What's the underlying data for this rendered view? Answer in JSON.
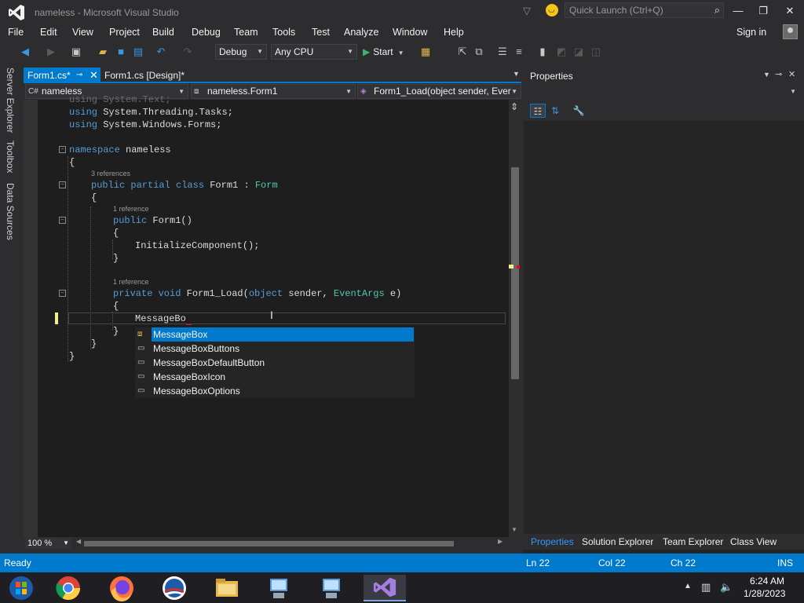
{
  "window": {
    "title": "nameless - Microsoft Visual Studio",
    "quick_launch_placeholder": "Quick Launch (Ctrl+Q)"
  },
  "menu": [
    "File",
    "Edit",
    "View",
    "Project",
    "Build",
    "Debug",
    "Team",
    "Tools",
    "Test",
    "Analyze",
    "Window",
    "Help"
  ],
  "sign_in": "Sign in",
  "toolbar": {
    "config": "Debug",
    "platform": "Any CPU",
    "start": "Start"
  },
  "left_tabs": [
    "Server Explorer",
    "Toolbox",
    "Data Sources"
  ],
  "doc_tabs": {
    "active": "Form1.cs*",
    "other": "Form1.cs [Design]*"
  },
  "navbar": {
    "project": "nameless",
    "class": "nameless.Form1",
    "member": "Form1_Load(object sender, Ever"
  },
  "code": {
    "using1": "using System.Text;",
    "using2_kw": "using",
    "using2_rest": " System.Threading.Tasks;",
    "using3_kw": "using",
    "using3_rest": " System.Windows.Forms;",
    "ns_kw": "namespace",
    "ns_name": " nameless",
    "brace_open": "{",
    "brace_close": "}",
    "lens_class": "3 references",
    "class_kw": "public partial class",
    "class_name": " Form1 ",
    "class_colon": ": ",
    "class_base": "Form",
    "lens_ctor": "1 reference",
    "ctor_kw": "public",
    "ctor_rest": " Form1()",
    "init": "InitializeComponent();",
    "lens_load": "1 reference",
    "load_kw": "private void",
    "load_name": " Form1_Load(",
    "load_obj": "object",
    "load_sender": " sender, ",
    "load_type": "EventArgs",
    "load_e": " e)",
    "typing": "MessageBo"
  },
  "intellisense": [
    {
      "label": "MessageBox",
      "icon": "class-icon",
      "selected": true
    },
    {
      "label": "MessageBoxButtons",
      "icon": "enum-icon",
      "selected": false
    },
    {
      "label": "MessageBoxDefaultButton",
      "icon": "enum-icon",
      "selected": false
    },
    {
      "label": "MessageBoxIcon",
      "icon": "enum-icon",
      "selected": false
    },
    {
      "label": "MessageBoxOptions",
      "icon": "enum-icon",
      "selected": false
    }
  ],
  "zoom": "100 %",
  "properties": {
    "title": "Properties",
    "bottom_tabs": [
      "Properties",
      "Solution Explorer",
      "Team Explorer",
      "Class View"
    ]
  },
  "status": {
    "ready": "Ready",
    "ln": "Ln 22",
    "col": "Col 22",
    "ch": "Ch 22",
    "mode": "INS"
  },
  "clock": {
    "time": "6:24 AM",
    "date": "1/28/2023"
  },
  "colors": {
    "accent": "#007acc",
    "keyword": "#569cd6",
    "type": "#4ec9b0"
  }
}
